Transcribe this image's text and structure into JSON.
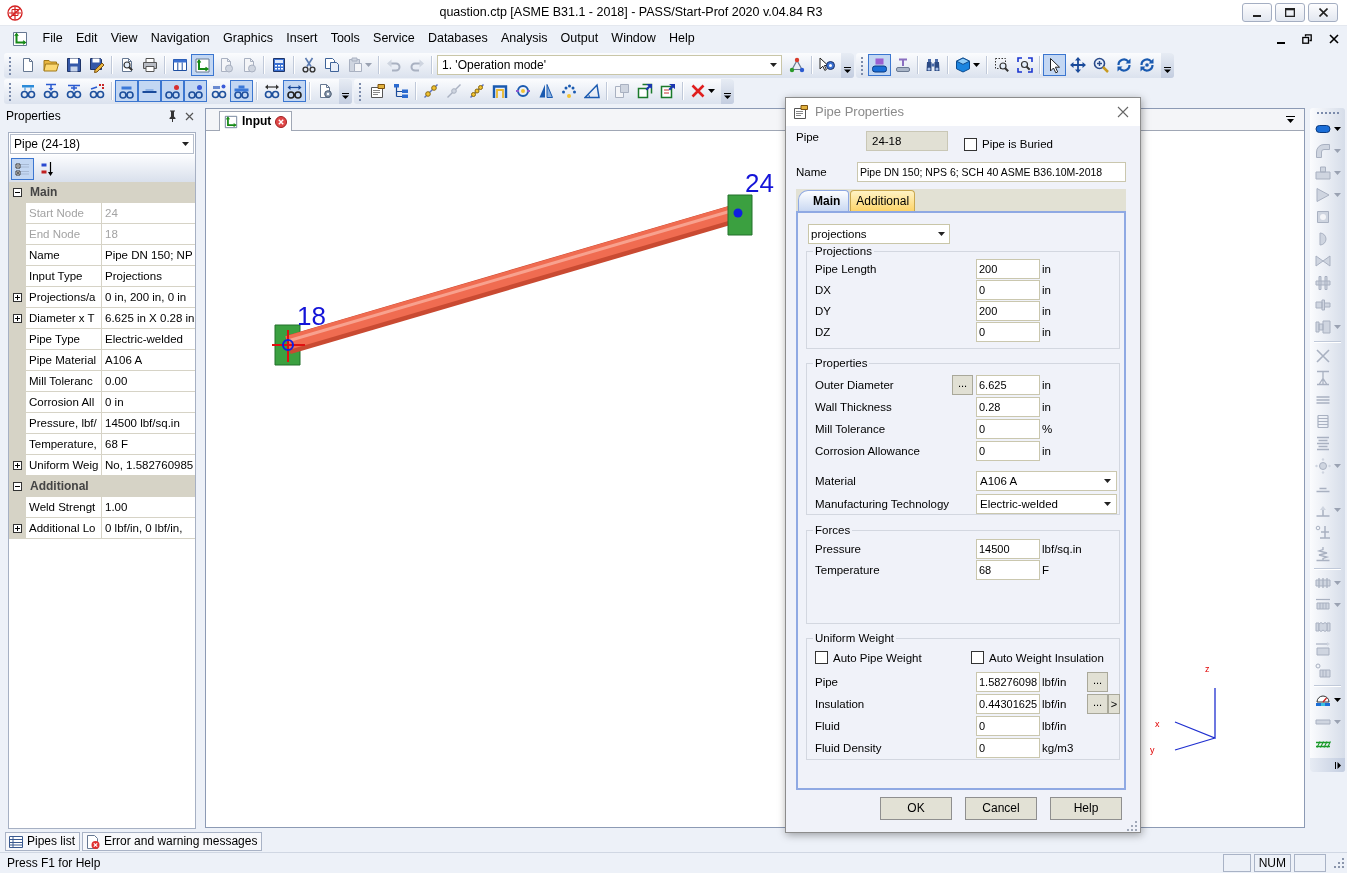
{
  "window": {
    "title": "quastion.ctp [ASME B31.1 - 2018] - PASS/Start-Prof 2020 v.04.84 R3"
  },
  "menu_bar": {
    "items": [
      "File",
      "Edit",
      "View",
      "Navigation",
      "Graphics",
      "Insert",
      "Tools",
      "Service",
      "Databases",
      "Analysis",
      "Output",
      "Window",
      "Help"
    ]
  },
  "toolbars": [
    {
      "groups": [
        [
          {
            "kind": "button",
            "pressed": false,
            "disabled": false,
            "menu": false
          },
          {
            "kind": "button",
            "pressed": false,
            "disabled": false,
            "menu": false
          },
          {
            "kind": "button",
            "pressed": false,
            "disabled": false,
            "menu": false
          },
          {
            "kind": "button",
            "pressed": false,
            "disabled": false,
            "menu": false
          }
        ],
        [
          {
            "kind": "button",
            "pressed": false,
            "disabled": false,
            "menu": false
          },
          {
            "kind": "button",
            "pressed": false,
            "disabled": false,
            "menu": false
          }
        ],
        [
          {
            "kind": "button",
            "pressed": false,
            "disabled": false,
            "menu": false
          },
          {
            "kind": "button",
            "pressed": true,
            "disabled": false,
            "menu": false
          },
          {
            "kind": "button",
            "pressed": false,
            "disabled": true,
            "menu": false
          },
          {
            "kind": "button",
            "pressed": false,
            "disabled": true,
            "menu": false
          }
        ],
        [
          {
            "kind": "button",
            "pressed": false,
            "disabled": false,
            "menu": false
          }
        ],
        [
          {
            "kind": "button",
            "pressed": false,
            "disabled": false,
            "menu": false
          },
          {
            "kind": "button",
            "pressed": false,
            "disabled": false,
            "menu": false
          },
          {
            "kind": "button",
            "pressed": false,
            "disabled": true,
            "menu": true
          }
        ],
        [
          {
            "kind": "button",
            "pressed": false,
            "disabled": true,
            "menu": false
          },
          {
            "kind": "button",
            "pressed": false,
            "disabled": true,
            "menu": false
          }
        ],
        [
          {
            "kind": "combo",
            "value": "1. 'Operation mode'"
          },
          {
            "kind": "button",
            "pressed": false,
            "disabled": false,
            "menu": false
          }
        ],
        [
          {
            "kind": "button",
            "pressed": false,
            "disabled": false,
            "menu": false
          }
        ]
      ]
    },
    {
      "groups": [
        [
          {
            "kind": "button",
            "pressed": true,
            "disabled": false,
            "menu": false
          },
          {
            "kind": "button",
            "pressed": false,
            "disabled": false,
            "menu": false
          }
        ],
        [
          {
            "kind": "button",
            "pressed": false,
            "disabled": false,
            "menu": false
          }
        ],
        [
          {
            "kind": "button",
            "pressed": false,
            "disabled": false,
            "menu": true
          }
        ],
        [
          {
            "kind": "button",
            "pressed": false,
            "disabled": false,
            "menu": false
          },
          {
            "kind": "button",
            "pressed": false,
            "disabled": false,
            "menu": false
          }
        ],
        [
          {
            "kind": "button",
            "pressed": true,
            "disabled": false,
            "menu": false
          },
          {
            "kind": "button",
            "pressed": false,
            "disabled": false,
            "menu": false
          },
          {
            "kind": "button",
            "pressed": false,
            "disabled": false,
            "menu": false
          },
          {
            "kind": "button",
            "pressed": false,
            "disabled": false,
            "menu": false
          },
          {
            "kind": "button",
            "pressed": false,
            "disabled": false,
            "menu": false
          }
        ]
      ]
    },
    {
      "groups": [
        [
          {
            "kind": "button",
            "pressed": false,
            "disabled": false,
            "menu": false
          },
          {
            "kind": "button",
            "pressed": false,
            "disabled": false,
            "menu": false
          },
          {
            "kind": "button",
            "pressed": false,
            "disabled": false,
            "menu": false
          },
          {
            "kind": "button",
            "pressed": false,
            "disabled": false,
            "menu": false
          }
        ],
        [
          {
            "kind": "button",
            "pressed": true,
            "disabled": false,
            "menu": false
          },
          {
            "kind": "button",
            "pressed": true,
            "disabled": false,
            "menu": false
          },
          {
            "kind": "button",
            "pressed": true,
            "disabled": false,
            "menu": false
          },
          {
            "kind": "button",
            "pressed": true,
            "disabled": false,
            "menu": false
          },
          {
            "kind": "button",
            "pressed": false,
            "disabled": false,
            "menu": false
          },
          {
            "kind": "button",
            "pressed": true,
            "disabled": false,
            "menu": false
          }
        ],
        [
          {
            "kind": "button",
            "pressed": false,
            "disabled": false,
            "menu": false
          },
          {
            "kind": "button",
            "pressed": true,
            "disabled": false,
            "menu": false
          }
        ],
        [
          {
            "kind": "button",
            "pressed": false,
            "disabled": false,
            "menu": false
          }
        ]
      ]
    },
    {
      "groups": [
        [
          {
            "kind": "button",
            "pressed": false,
            "disabled": false,
            "menu": false
          },
          {
            "kind": "button",
            "pressed": false,
            "disabled": false,
            "menu": false
          }
        ],
        [
          {
            "kind": "button",
            "pressed": false,
            "disabled": false,
            "menu": false
          },
          {
            "kind": "button",
            "pressed": false,
            "disabled": true,
            "menu": false
          },
          {
            "kind": "button",
            "pressed": false,
            "disabled": false,
            "menu": false
          },
          {
            "kind": "button",
            "pressed": false,
            "disabled": false,
            "menu": false
          },
          {
            "kind": "button",
            "pressed": false,
            "disabled": false,
            "menu": false
          },
          {
            "kind": "button",
            "pressed": false,
            "disabled": false,
            "menu": false
          },
          {
            "kind": "button",
            "pressed": false,
            "disabled": false,
            "menu": false
          },
          {
            "kind": "button",
            "pressed": false,
            "disabled": false,
            "menu": false
          }
        ],
        [
          {
            "kind": "button",
            "pressed": false,
            "disabled": true,
            "menu": false
          },
          {
            "kind": "button",
            "pressed": false,
            "disabled": false,
            "menu": false
          },
          {
            "kind": "button",
            "pressed": false,
            "disabled": false,
            "menu": false
          }
        ],
        [
          {
            "kind": "button",
            "pressed": false,
            "disabled": false,
            "menu": true
          }
        ]
      ]
    }
  ],
  "properties_panel": {
    "title": "Properties",
    "object": "Pipe (24-18)",
    "view_buttons": [
      {
        "pressed": true
      },
      {
        "pressed": false
      }
    ],
    "categories": [
      {
        "name": "Main",
        "expanded": true,
        "rows": [
          {
            "name": "Start Node",
            "value": "24",
            "kind": "plain",
            "readonly": true
          },
          {
            "name": "End Node",
            "value": "18",
            "kind": "plain",
            "readonly": true
          },
          {
            "name": "Name",
            "value": "Pipe DN 150; NP",
            "kind": "plain",
            "readonly": false
          },
          {
            "name": "Input Type",
            "value": "Projections",
            "kind": "plain",
            "readonly": false
          },
          {
            "name": "Projections/a",
            "value": "0 in, 200 in, 0 in",
            "kind": "expandable",
            "expanded": false,
            "readonly": false
          },
          {
            "name": "Diameter x T",
            "value": "6.625 in X 0.28 in",
            "kind": "expandable",
            "expanded": false,
            "readonly": false
          },
          {
            "name": "Pipe Type",
            "value": "Electric-welded",
            "kind": "plain",
            "readonly": false
          },
          {
            "name": "Pipe Material",
            "value": "A106 A",
            "kind": "plain",
            "readonly": false
          },
          {
            "name": "Mill Toleranc",
            "value": "0.00",
            "kind": "plain",
            "readonly": false
          },
          {
            "name": "Corrosion All",
            "value": "0 in",
            "kind": "plain",
            "readonly": false
          },
          {
            "name": "Pressure, lbf/",
            "value": "14500 lbf/sq.in",
            "kind": "plain",
            "readonly": false
          },
          {
            "name": "Temperature,",
            "value": "68 F",
            "kind": "plain",
            "readonly": false
          },
          {
            "name": "Uniform Weig",
            "value": "No, 1.582760985",
            "kind": "expandable",
            "expanded": false,
            "readonly": false
          }
        ]
      },
      {
        "name": "Additional",
        "expanded": true,
        "rows": [
          {
            "name": "Weld Strengt",
            "value": "1.00",
            "kind": "plain",
            "readonly": false
          },
          {
            "name": "Additional Lo",
            "value": "0 lbf/in, 0 lbf/in,",
            "kind": "expandable",
            "expanded": false,
            "readonly": false
          }
        ]
      }
    ]
  },
  "document_tabs": [
    {
      "label": "Input",
      "selected": true
    }
  ],
  "canvas": {
    "nodes": [
      {
        "label": "18"
      },
      {
        "label": "24"
      }
    ],
    "axes": [
      "z",
      "x",
      "y"
    ]
  },
  "side_toolbar": {
    "groups": [
      [
        {
          "kind": "button",
          "pressed": false,
          "disabled": false,
          "menu": true
        },
        {
          "kind": "button",
          "pressed": false,
          "disabled": true,
          "menu": true
        },
        {
          "kind": "button",
          "pressed": false,
          "disabled": true,
          "menu": true
        },
        {
          "kind": "button",
          "pressed": false,
          "disabled": true,
          "menu": true
        },
        {
          "kind": "button",
          "pressed": false,
          "disabled": true,
          "menu": false
        },
        {
          "kind": "button",
          "pressed": false,
          "disabled": true,
          "menu": false
        },
        {
          "kind": "button",
          "pressed": false,
          "disabled": true,
          "menu": false
        },
        {
          "kind": "button",
          "pressed": false,
          "disabled": true,
          "menu": false
        },
        {
          "kind": "button",
          "pressed": false,
          "disabled": true,
          "menu": false
        },
        {
          "kind": "button",
          "pressed": false,
          "disabled": true,
          "menu": true
        }
      ],
      [
        {
          "kind": "button",
          "pressed": false,
          "disabled": true,
          "menu": false
        },
        {
          "kind": "button",
          "pressed": false,
          "disabled": true,
          "menu": false
        },
        {
          "kind": "button",
          "pressed": false,
          "disabled": true,
          "menu": false
        },
        {
          "kind": "button",
          "pressed": false,
          "disabled": true,
          "menu": false
        },
        {
          "kind": "button",
          "pressed": false,
          "disabled": true,
          "menu": false
        },
        {
          "kind": "button",
          "pressed": false,
          "disabled": true,
          "menu": true
        },
        {
          "kind": "button",
          "pressed": false,
          "disabled": true,
          "menu": false
        },
        {
          "kind": "button",
          "pressed": false,
          "disabled": true,
          "menu": true
        },
        {
          "kind": "button",
          "pressed": false,
          "disabled": true,
          "menu": false
        },
        {
          "kind": "button",
          "pressed": false,
          "disabled": true,
          "menu": false
        }
      ],
      [
        {
          "kind": "button",
          "pressed": false,
          "disabled": true,
          "menu": true
        },
        {
          "kind": "button",
          "pressed": false,
          "disabled": true,
          "menu": true
        },
        {
          "kind": "button",
          "pressed": false,
          "disabled": true,
          "menu": false
        },
        {
          "kind": "button",
          "pressed": false,
          "disabled": true,
          "menu": false
        },
        {
          "kind": "button",
          "pressed": false,
          "disabled": true,
          "menu": false
        }
      ],
      [
        {
          "kind": "button",
          "pressed": false,
          "disabled": false,
          "menu": true
        },
        {
          "kind": "button",
          "pressed": false,
          "disabled": true,
          "menu": true
        },
        {
          "kind": "button",
          "pressed": false,
          "disabled": false,
          "menu": false
        }
      ]
    ]
  },
  "dialog": {
    "title": "Pipe Properties",
    "pipe": {
      "label": "Pipe",
      "value": "24-18"
    },
    "buried": {
      "label": "Pipe is Buried",
      "checked": false
    },
    "name": {
      "label": "Name",
      "value": "Pipe DN 150; NPS 6; SCH 40 ASME B36.10M-2018"
    },
    "tabs": [
      {
        "label": "Main",
        "selected": true
      },
      {
        "label": "Additional",
        "selected": false
      }
    ],
    "input_mode": "projections",
    "groups": [
      {
        "title": "Projections",
        "rows": [
          {
            "kind": "input",
            "label": "Pipe Length",
            "value": "200",
            "unit": "in"
          },
          {
            "kind": "input",
            "label": "DX",
            "value": "0",
            "unit": "in"
          },
          {
            "kind": "input",
            "label": "DY",
            "value": "200",
            "unit": "in"
          },
          {
            "kind": "input",
            "label": "DZ",
            "value": "0",
            "unit": "in"
          }
        ]
      },
      {
        "title": "Properties",
        "rows": [
          {
            "kind": "input",
            "label": "Outer Diameter",
            "browse": "...",
            "value": "6.625",
            "unit": "in"
          },
          {
            "kind": "input",
            "label": "Wall Thickness",
            "value": "0.28",
            "unit": "in"
          },
          {
            "kind": "input",
            "label": "Mill Tolerance",
            "value": "0",
            "unit": "%"
          },
          {
            "kind": "input",
            "label": "Corrosion Allowance",
            "value": "0",
            "unit": "in"
          },
          {
            "kind": "select",
            "label": "Material",
            "value": "A106 A"
          },
          {
            "kind": "select",
            "label": "Manufacturing Technology",
            "value": "Electric-welded"
          }
        ]
      },
      {
        "title": "Forces",
        "rows": [
          {
            "kind": "input",
            "label": "Pressure",
            "value": "14500",
            "unit": "lbf/sq.in"
          },
          {
            "kind": "input",
            "label": "Temperature",
            "value": "68",
            "unit": "F"
          }
        ]
      },
      {
        "title": "Uniform Weight",
        "checks": [
          {
            "label": "Auto Pipe Weight",
            "checked": false
          },
          {
            "label": "Auto Weight Insulation",
            "checked": false
          }
        ],
        "rows": [
          {
            "kind": "input",
            "label": "Pipe",
            "value": "1.58276098",
            "unit": "lbf/in",
            "actions": [
              "..."
            ]
          },
          {
            "kind": "input",
            "label": "Insulation",
            "value": "0.44301625",
            "unit": "lbf/in",
            "actions": [
              "...",
              ">"
            ]
          },
          {
            "kind": "input",
            "label": "Fluid",
            "value": "0",
            "unit": "lbf/in"
          },
          {
            "kind": "input",
            "label": "Fluid Density",
            "value": "0",
            "unit": "kg/m3"
          }
        ]
      }
    ],
    "buttons": [
      "OK",
      "Cancel",
      "Help"
    ]
  },
  "bottom_tabs": [
    {
      "label": "Pipes list"
    },
    {
      "label": "Error and warning messages"
    }
  ],
  "status_bar": {
    "text": "Press F1 for Help",
    "indicator": "NUM"
  }
}
